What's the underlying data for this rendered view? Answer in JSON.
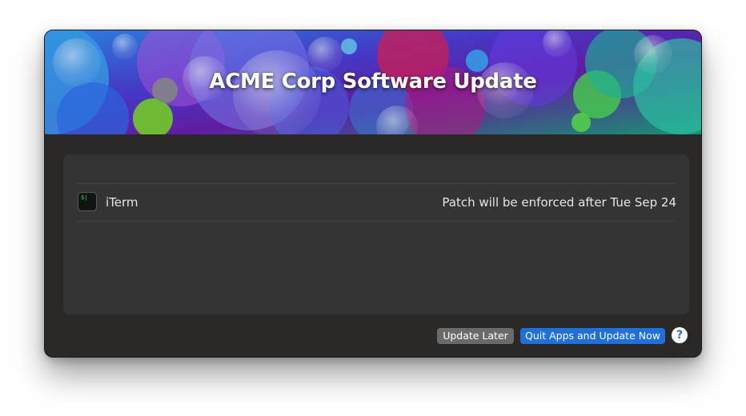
{
  "banner": {
    "title": "ACME Corp Software Update"
  },
  "updates": [
    {
      "app_name": "iTerm",
      "icon": "terminal-icon",
      "icon_text": "$|",
      "status": "Patch will be enforced after Tue Sep 24"
    }
  ],
  "buttons": {
    "later_label": "Update Later",
    "now_label": "Quit Apps and Update Now",
    "help_label": "?"
  },
  "colors": {
    "window_bg": "#2b2927",
    "panel_bg": "#343434",
    "primary_button": "#1f6fdc",
    "secondary_button": "#6a6a6a"
  }
}
